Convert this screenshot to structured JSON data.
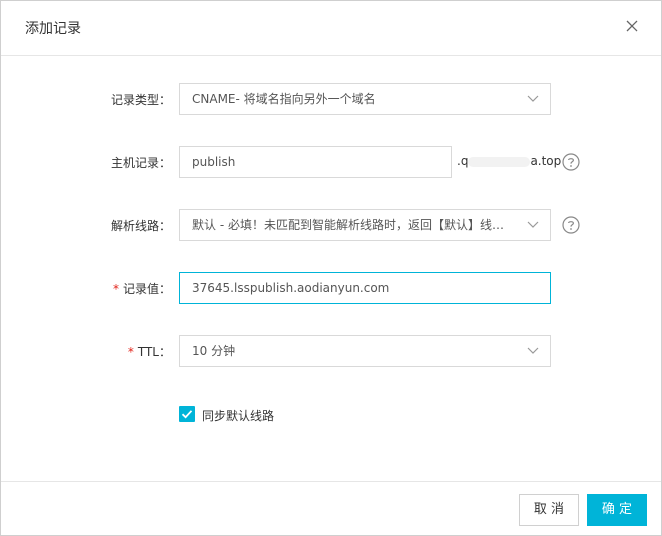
{
  "dialog": {
    "title": "添加记录",
    "close_icon": "close-icon"
  },
  "form": {
    "record_type": {
      "label": "记录类型：",
      "value": "CNAME- 将域名指向另外一个域名"
    },
    "host": {
      "label": "主机记录：",
      "value": "publish",
      "suffix_start": ".q",
      "suffix_end": "a.top"
    },
    "line": {
      "label": "解析线路：",
      "value": "默认 - 必填！未匹配到智能解析线路时，返回【默认】线路..."
    },
    "record_value": {
      "required_mark": "*",
      "label": "记录值：",
      "value": "37645.lsspublish.aodianyun.com"
    },
    "ttl": {
      "required_mark": "*",
      "label": "TTL：",
      "value": "10 分钟"
    },
    "sync_default": {
      "label": "同步默认线路",
      "checked": true
    }
  },
  "footer": {
    "cancel_label": "取 消",
    "ok_label": "确 定"
  },
  "colors": {
    "accent": "#00b4d8",
    "required": "#e2231a"
  }
}
